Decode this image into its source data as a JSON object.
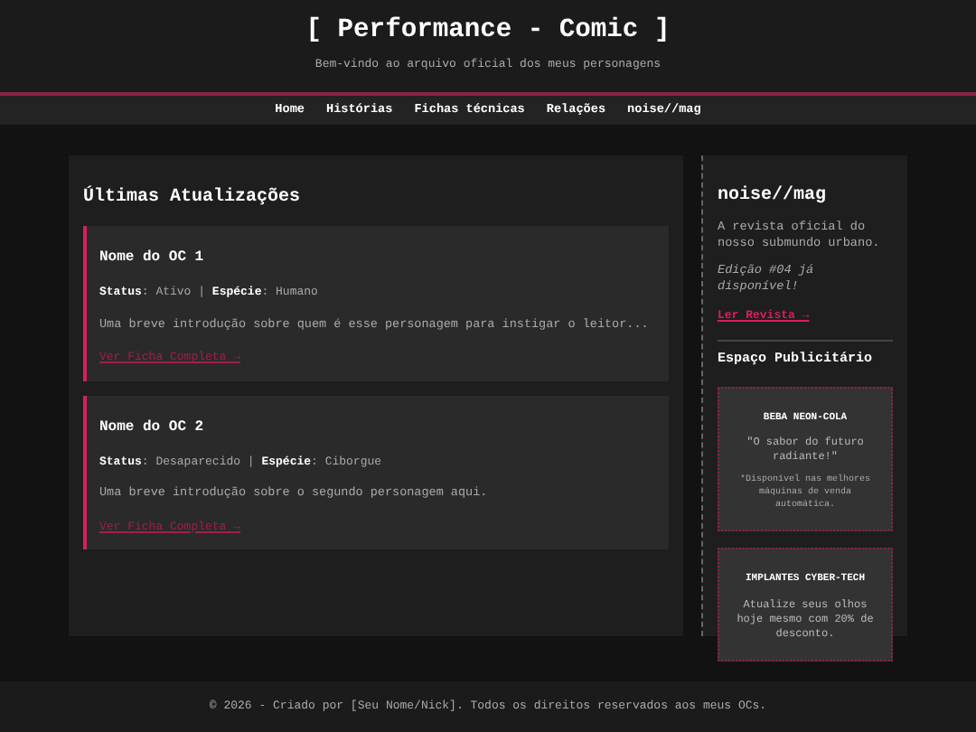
{
  "header": {
    "title": "[ Performance - Comic ]",
    "subtitle": "Bem-vindo ao arquivo oficial dos meus personagens"
  },
  "nav": [
    "Home",
    "Histórias",
    "Fichas técnicas",
    "Relações",
    "noise//mag"
  ],
  "main": {
    "heading": "Últimas Atualizações",
    "cards": [
      {
        "name": "Nome do OC 1",
        "meta": "**Status**: Ativo | **Espécie**: Humano",
        "intro": "Uma breve introdução sobre quem é esse personagem para instigar o leitor...",
        "link": "Ver Ficha Completa →"
      },
      {
        "name": "Nome do OC 2",
        "meta": "**Status**: Desaparecido | **Espécie**: Ciborgue",
        "intro": "Uma breve introdução sobre o segundo personagem aqui.",
        "link": "Ver Ficha Completa →"
      }
    ]
  },
  "sidebar": {
    "heading": "noise//mag",
    "description": "A revista oficial do nosso submundo urbano.",
    "edition": "Edição #04 já disponível!",
    "link": "Ler Revista →",
    "ads_heading": "Espaço Publicitário",
    "ads": [
      {
        "title": "BEBA NEON-COLA",
        "text": "\"O sabor do futuro radiante!\"",
        "note": "*Disponível nas melhores máquinas de venda automática."
      },
      {
        "title": "IMPLANTES CYBER-TECH",
        "text": "Atualize seus olhos hoje mesmo com 20% de desconto."
      }
    ]
  },
  "footer": "© 2026 - Criado por [Seu Nome/Nick]. Todos os direitos reservados aos meus OCs."
}
